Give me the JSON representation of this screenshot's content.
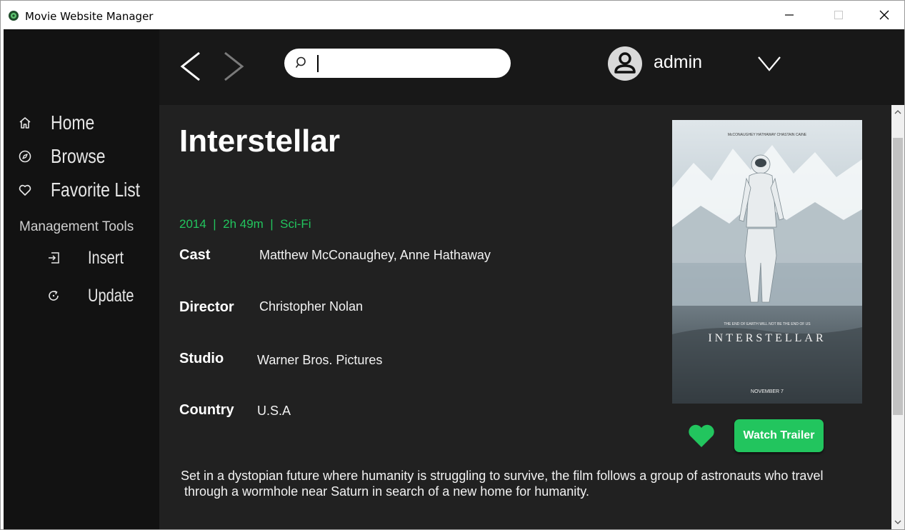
{
  "window": {
    "title": "Movie Website Manager"
  },
  "sidebar": {
    "items": [
      {
        "label": "Home",
        "icon": "home-icon"
      },
      {
        "label": "Browse",
        "icon": "compass-icon"
      },
      {
        "label": "Favorite List",
        "icon": "heart-outline-icon"
      }
    ],
    "management_title": "Management Tools",
    "tools": [
      {
        "label": "Insert",
        "icon": "insert-icon"
      },
      {
        "label": "Update",
        "icon": "refresh-icon"
      }
    ]
  },
  "topbar": {
    "search": {
      "value": "",
      "placeholder": ""
    },
    "user": {
      "name": "admin"
    }
  },
  "movie": {
    "title": "Interstellar",
    "meta": "2014  |  2h 49m  |  Sci-Fi",
    "info": {
      "cast_label": "Cast",
      "cast": "Matthew McConaughey, Anne Hathaway",
      "director_label": "Director",
      "director": "Christopher Nolan",
      "studio_label": "Studio",
      "studio": "Warner Bros. Pictures",
      "country_label": "Country",
      "country": "U.S.A"
    },
    "poster": {
      "credits": "McCONAUGHEY    HATHAWAY    CHASTAIN    CAINE",
      "tagline": "THE END OF EARTH WILL NOT BE THE END OF US",
      "title": "INTERSTELLAR",
      "release": "NOVEMBER 7"
    },
    "trailer_label": "Watch Trailer",
    "synopsis_lines": [
      "Set in a dystopian future where humanity is struggling to survive, the film follows a group of astronauts who travel",
      " through a wormhole near Saturn in search of a new home for humanity."
    ]
  },
  "colors": {
    "accent": "#22c55e",
    "sidebar": "#121212",
    "topbar": "#181818",
    "content": "#212121"
  }
}
